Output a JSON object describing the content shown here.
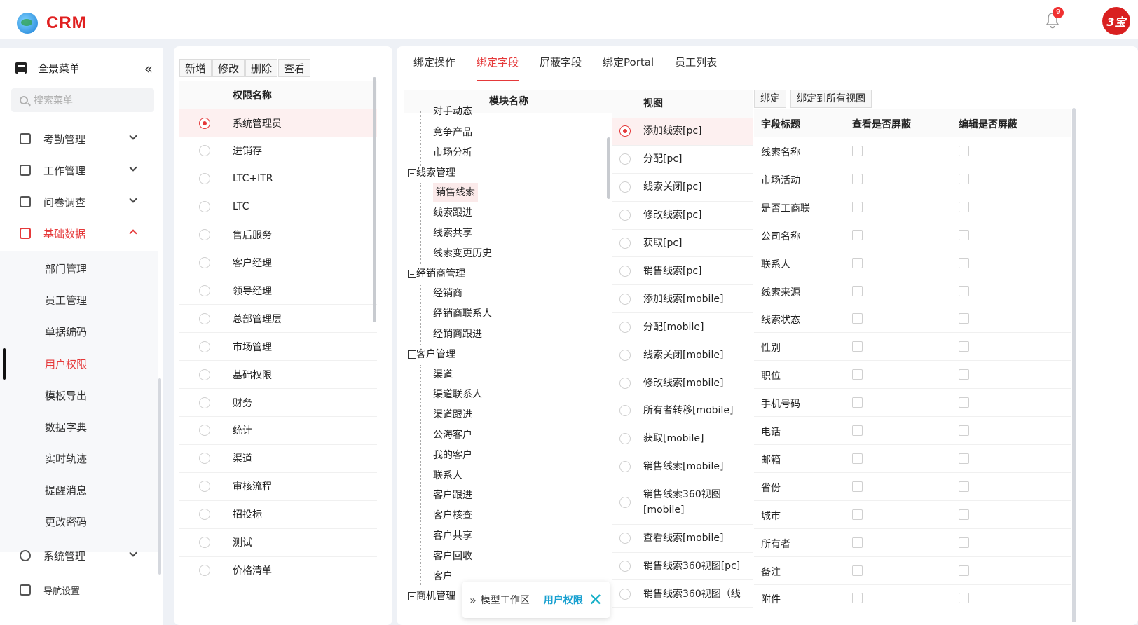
{
  "brand": {
    "logo_text": "CRM",
    "notification_count": "9",
    "avatar_text": "3宝"
  },
  "sidebar": {
    "full_menu_label": "全景菜单",
    "collapse_glyph": "«",
    "search_placeholder": "搜索菜单",
    "groups": [
      {
        "label": "考勤管理",
        "active": false
      },
      {
        "label": "工作管理",
        "active": false
      },
      {
        "label": "问卷调查",
        "active": false
      },
      {
        "label": "基础数据",
        "active": true
      }
    ],
    "sub_items": [
      {
        "label": "部门管理"
      },
      {
        "label": "员工管理"
      },
      {
        "label": "单据编码"
      },
      {
        "label": "用户权限",
        "active": true
      },
      {
        "label": "模板导出"
      },
      {
        "label": "数据字典"
      },
      {
        "label": "实时轨迹"
      },
      {
        "label": "提醒消息"
      },
      {
        "label": "更改密码"
      }
    ],
    "bottom_groups": [
      {
        "label": "系统管理"
      },
      {
        "label": "导航设置"
      }
    ]
  },
  "roles": {
    "buttons": [
      "新增",
      "修改",
      "删除",
      "查看"
    ],
    "header": "权限名称",
    "rows": [
      "系统管理员",
      "进销存",
      "LTC+ITR",
      "LTC",
      "售后服务",
      "客户经理",
      "领导经理",
      "总部管理层",
      "市场管理",
      "基础权限",
      "财务",
      "统计",
      "渠道",
      "审核流程",
      "招投标",
      "测试",
      "价格清单"
    ],
    "selected_index": 0
  },
  "tabs": {
    "items": [
      "绑定操作",
      "绑定字段",
      "屏蔽字段",
      "绑定Portal",
      "员工列表"
    ],
    "active_index": 1
  },
  "tree": {
    "header": "模块名称",
    "top_clipped": "对手动态",
    "children_top": [
      "竞争产品",
      "市场分析"
    ],
    "group1": {
      "label": "线索管理",
      "children": [
        "销售线索",
        "线索跟进",
        "线索共享",
        "线索变更历史"
      ]
    },
    "group2": {
      "label": "经销商管理",
      "children": [
        "经销商",
        "经销商联系人",
        "经销商跟进"
      ]
    },
    "group3": {
      "label": "客户管理",
      "children": [
        "渠道",
        "渠道联系人",
        "渠道跟进",
        "公海客户",
        "我的客户",
        "联系人",
        "客户跟进",
        "客户核查",
        "客户共享",
        "客户回收",
        "客户"
      ]
    },
    "group4": {
      "label": "商机管理"
    }
  },
  "views": {
    "header": "视图",
    "rows": [
      "添加线索[pc]",
      "分配[pc]",
      "线索关闭[pc]",
      "修改线索[pc]",
      "获取[pc]",
      "销售线索[pc]",
      "添加线索[mobile]",
      "分配[mobile]",
      "线索关闭[mobile]",
      "修改线索[mobile]",
      "所有者转移[mobile]",
      "获取[mobile]",
      "销售线索[mobile]",
      "销售线索360视图[mobile]",
      "查看线索[mobile]",
      "销售线索360视图[pc]",
      "销售线索360视图（线"
    ],
    "selected_index": 0
  },
  "fields": {
    "buttons": [
      "绑定",
      "绑定到所有视图"
    ],
    "headers": [
      "字段标题",
      "查看是否屏蔽",
      "编辑是否屏蔽"
    ],
    "rows": [
      "线索名称",
      "市场活动",
      "是否工商联",
      "公司名称",
      "联系人",
      "线索来源",
      "线索状态",
      "性别",
      "职位",
      "手机号码",
      "电话",
      "邮箱",
      "省份",
      "城市",
      "所有者",
      "备注",
      "附件"
    ]
  },
  "floating_bar": {
    "prefix": "»",
    "workspace_label": "模型工作区",
    "current_label": "用户权限",
    "close_glyph": "✕"
  },
  "colors": {
    "accent": "#e5393a",
    "link": "#18a0d0"
  }
}
